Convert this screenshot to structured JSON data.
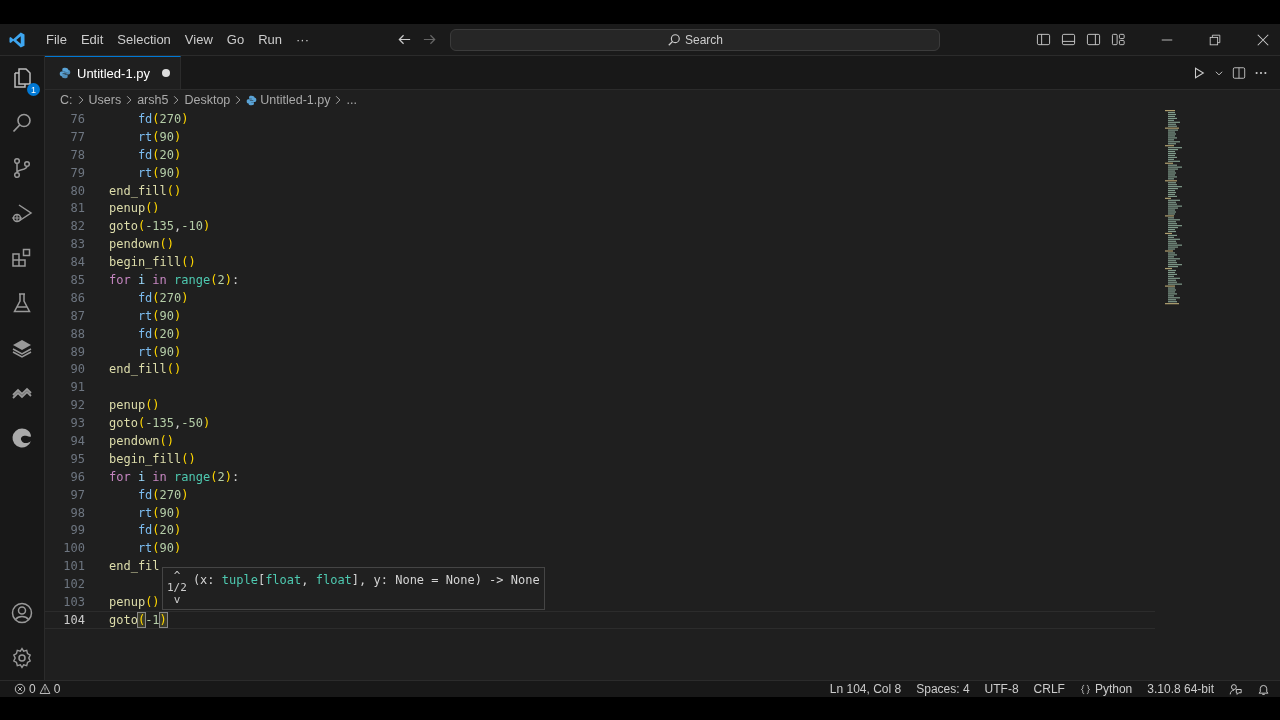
{
  "menu": [
    "File",
    "Edit",
    "Selection",
    "View",
    "Go",
    "Run",
    "···"
  ],
  "search": {
    "placeholder": "Search"
  },
  "activity_bar": {
    "explorer_badge": "1"
  },
  "tabs": [
    {
      "label": "Untitled-1.py",
      "selected": true,
      "unsaved": true
    }
  ],
  "breadcrumb": [
    "C:",
    "Users",
    "arsh5",
    "Desktop",
    "Untitled-1.py",
    "..."
  ],
  "lines": [
    {
      "number": "76",
      "current": false,
      "tokens": [
        {
          "text": "    fd",
          "kind": "call"
        },
        {
          "text": "(",
          "kind": "paren"
        },
        {
          "text": "270",
          "kind": "num"
        },
        {
          "text": ")",
          "kind": "paren"
        }
      ]
    },
    {
      "number": "77",
      "current": false,
      "tokens": [
        {
          "text": "    rt",
          "kind": "call"
        },
        {
          "text": "(",
          "kind": "paren"
        },
        {
          "text": "90",
          "kind": "num"
        },
        {
          "text": ")",
          "kind": "paren"
        }
      ]
    },
    {
      "number": "78",
      "current": false,
      "tokens": [
        {
          "text": "    fd",
          "kind": "call"
        },
        {
          "text": "(",
          "kind": "paren"
        },
        {
          "text": "20",
          "kind": "num"
        },
        {
          "text": ")",
          "kind": "paren"
        }
      ]
    },
    {
      "number": "79",
      "current": false,
      "tokens": [
        {
          "text": "    rt",
          "kind": "call"
        },
        {
          "text": "(",
          "kind": "paren"
        },
        {
          "text": "90",
          "kind": "num"
        },
        {
          "text": ")",
          "kind": "paren"
        }
      ]
    },
    {
      "number": "80",
      "current": false,
      "tokens": [
        {
          "text": "end_fill",
          "kind": "fn"
        },
        {
          "text": "()",
          "kind": "paren"
        }
      ]
    },
    {
      "number": "81",
      "current": false,
      "tokens": [
        {
          "text": "penup",
          "kind": "fn"
        },
        {
          "text": "()",
          "kind": "paren"
        }
      ]
    },
    {
      "number": "82",
      "current": false,
      "tokens": [
        {
          "text": "goto",
          "kind": "fn"
        },
        {
          "text": "(",
          "kind": "paren"
        },
        {
          "text": "-135",
          "kind": "num"
        },
        {
          "text": ",",
          "kind": "punct"
        },
        {
          "text": "-10",
          "kind": "num"
        },
        {
          "text": ")",
          "kind": "paren"
        }
      ]
    },
    {
      "number": "83",
      "current": false,
      "tokens": [
        {
          "text": "pendown",
          "kind": "fn"
        },
        {
          "text": "()",
          "kind": "paren"
        }
      ]
    },
    {
      "number": "84",
      "current": false,
      "tokens": [
        {
          "text": "begin_fill",
          "kind": "fn"
        },
        {
          "text": "()",
          "kind": "paren"
        }
      ]
    },
    {
      "number": "85",
      "current": false,
      "tokens": [
        {
          "text": "for",
          "kind": "kw"
        },
        {
          "text": " i",
          "kind": "var"
        },
        {
          "text": " in",
          "kind": "kw"
        },
        {
          "text": " range",
          "kind": "builtin"
        },
        {
          "text": "(",
          "kind": "paren"
        },
        {
          "text": "2",
          "kind": "num"
        },
        {
          "text": ")",
          "kind": "paren"
        },
        {
          "text": ":",
          "kind": "punct"
        }
      ]
    },
    {
      "number": "86",
      "current": false,
      "tokens": [
        {
          "text": "    fd",
          "kind": "call"
        },
        {
          "text": "(",
          "kind": "paren"
        },
        {
          "text": "270",
          "kind": "num"
        },
        {
          "text": ")",
          "kind": "paren"
        }
      ]
    },
    {
      "number": "87",
      "current": false,
      "tokens": [
        {
          "text": "    rt",
          "kind": "call"
        },
        {
          "text": "(",
          "kind": "paren"
        },
        {
          "text": "90",
          "kind": "num"
        },
        {
          "text": ")",
          "kind": "paren"
        }
      ]
    },
    {
      "number": "88",
      "current": false,
      "tokens": [
        {
          "text": "    fd",
          "kind": "call"
        },
        {
          "text": "(",
          "kind": "paren"
        },
        {
          "text": "20",
          "kind": "num"
        },
        {
          "text": ")",
          "kind": "paren"
        }
      ]
    },
    {
      "number": "89",
      "current": false,
      "tokens": [
        {
          "text": "    rt",
          "kind": "call"
        },
        {
          "text": "(",
          "kind": "paren"
        },
        {
          "text": "90",
          "kind": "num"
        },
        {
          "text": ")",
          "kind": "paren"
        }
      ]
    },
    {
      "number": "90",
      "current": false,
      "tokens": [
        {
          "text": "end_fill",
          "kind": "fn"
        },
        {
          "text": "()",
          "kind": "paren"
        }
      ]
    },
    {
      "number": "91",
      "current": false
    },
    {
      "number": "92",
      "current": false,
      "tokens": [
        {
          "text": "penup",
          "kind": "fn"
        },
        {
          "text": "()",
          "kind": "paren"
        }
      ]
    },
    {
      "number": "93",
      "current": false,
      "tokens": [
        {
          "text": "goto",
          "kind": "fn"
        },
        {
          "text": "(",
          "kind": "paren"
        },
        {
          "text": "-135",
          "kind": "num"
        },
        {
          "text": ",",
          "kind": "punct"
        },
        {
          "text": "-50",
          "kind": "num"
        },
        {
          "text": ")",
          "kind": "paren"
        }
      ]
    },
    {
      "number": "94",
      "current": false,
      "tokens": [
        {
          "text": "pendown",
          "kind": "fn"
        },
        {
          "text": "()",
          "kind": "paren"
        }
      ]
    },
    {
      "number": "95",
      "current": false,
      "tokens": [
        {
          "text": "begin_fill",
          "kind": "fn"
        },
        {
          "text": "()",
          "kind": "paren"
        }
      ]
    },
    {
      "number": "96",
      "current": false,
      "tokens": [
        {
          "text": "for",
          "kind": "kw"
        },
        {
          "text": " i",
          "kind": "var"
        },
        {
          "text": " in",
          "kind": "kw"
        },
        {
          "text": " range",
          "kind": "builtin"
        },
        {
          "text": "(",
          "kind": "paren"
        },
        {
          "text": "2",
          "kind": "num"
        },
        {
          "text": ")",
          "kind": "paren"
        },
        {
          "text": ":",
          "kind": "punct"
        }
      ]
    },
    {
      "number": "97",
      "current": false,
      "tokens": [
        {
          "text": "    fd",
          "kind": "call"
        },
        {
          "text": "(",
          "kind": "paren"
        },
        {
          "text": "270",
          "kind": "num"
        },
        {
          "text": ")",
          "kind": "paren"
        }
      ]
    },
    {
      "number": "98",
      "current": false,
      "tokens": [
        {
          "text": "    rt",
          "kind": "call"
        },
        {
          "text": "(",
          "kind": "paren"
        },
        {
          "text": "90",
          "kind": "num"
        },
        {
          "text": ")",
          "kind": "paren"
        }
      ]
    },
    {
      "number": "99",
      "current": false,
      "tokens": [
        {
          "text": "    fd",
          "kind": "call"
        },
        {
          "text": "(",
          "kind": "paren"
        },
        {
          "text": "20",
          "kind": "num"
        },
        {
          "text": ")",
          "kind": "paren"
        }
      ]
    },
    {
      "number": "100",
      "current": false,
      "tokens": [
        {
          "text": "    rt",
          "kind": "call"
        },
        {
          "text": "(",
          "kind": "paren"
        },
        {
          "text": "90",
          "kind": "num"
        },
        {
          "text": ")",
          "kind": "paren"
        }
      ]
    },
    {
      "number": "101",
      "current": false,
      "tokens": [
        {
          "text": "end_fil",
          "kind": "fn"
        }
      ]
    },
    {
      "number": "102",
      "current": false
    },
    {
      "number": "103",
      "current": false,
      "tokens": [
        {
          "text": "penup",
          "kind": "fn"
        },
        {
          "text": "()",
          "kind": "paren"
        }
      ]
    },
    {
      "number": "104",
      "current": true,
      "tokens": [
        {
          "text": "goto",
          "kind": "fn"
        },
        {
          "text": "(",
          "kind": "match"
        },
        {
          "text": "-1",
          "kind": "num"
        },
        {
          "text": ")",
          "kind": "match"
        }
      ]
    }
  ],
  "signature_popup": {
    "up": "^",
    "counter": "1/2",
    "down": "v",
    "tokens": [
      {
        "text": "(x: ",
        "kind": "punct"
      },
      {
        "text": "tuple",
        "kind": "type"
      },
      {
        "text": "[",
        "kind": "punct"
      },
      {
        "text": "float",
        "kind": "type"
      },
      {
        "text": ", ",
        "kind": "punct"
      },
      {
        "text": "float",
        "kind": "type"
      },
      {
        "text": "], y: None = None) -> None",
        "kind": "punct"
      }
    ]
  },
  "status_bar": {
    "errors": "0",
    "warnings": "0",
    "items": [
      "Ln 104, Col 8",
      "Spaces: 4",
      "UTF-8",
      "CRLF",
      "Python",
      "3.10.8 64-bit"
    ]
  }
}
